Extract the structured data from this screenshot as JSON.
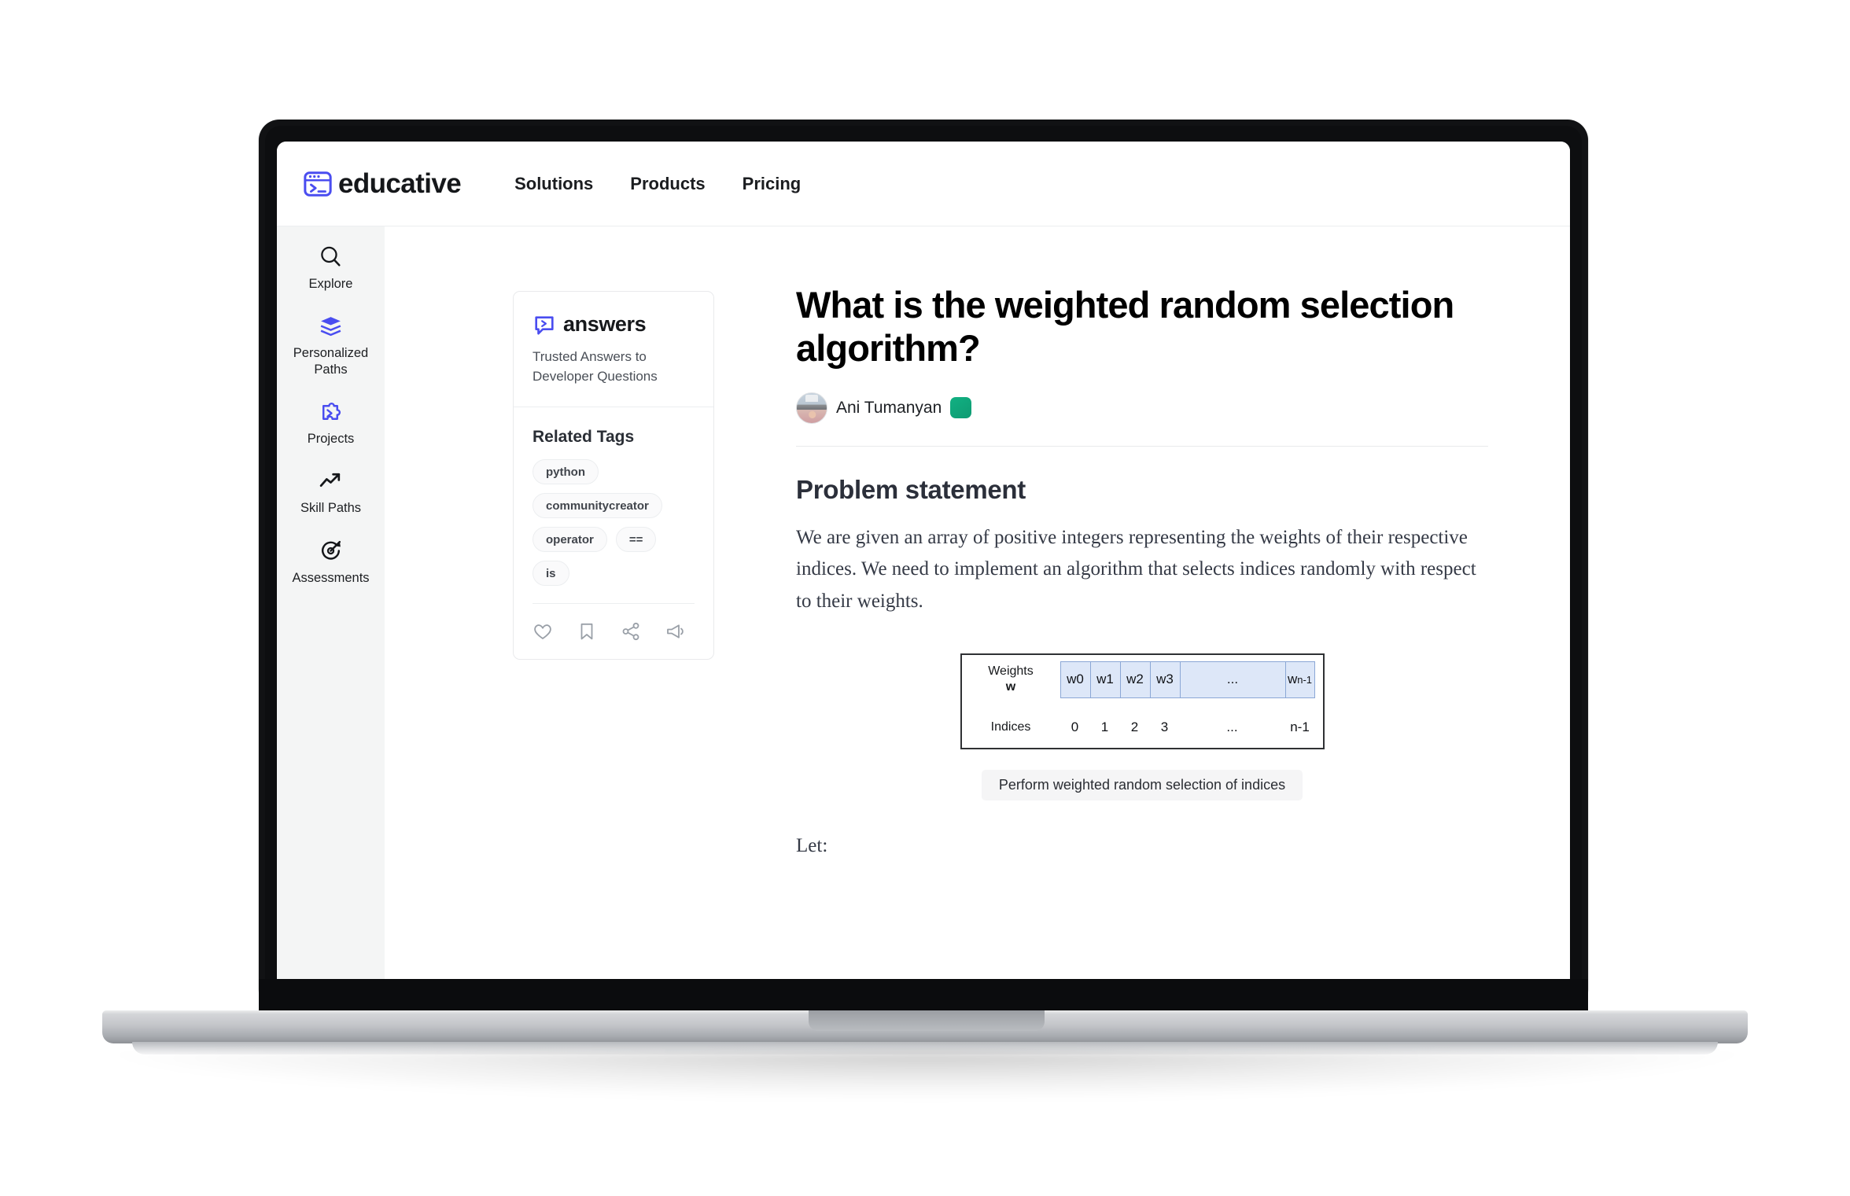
{
  "site": {
    "brand_name": "educative",
    "brand_icon": "terminal-window-icon",
    "nav": [
      {
        "label": "Solutions"
      },
      {
        "label": "Products"
      },
      {
        "label": "Pricing"
      }
    ]
  },
  "sidebar": {
    "items": [
      {
        "label": "Explore",
        "icon": "search-icon"
      },
      {
        "label": "Personalized Paths",
        "icon": "books-icon"
      },
      {
        "label": "Projects",
        "icon": "puzzle-code-icon"
      },
      {
        "label": "Skill Paths",
        "icon": "trending-up-icon"
      },
      {
        "label": "Assessments",
        "icon": "target-arrow-icon"
      }
    ]
  },
  "answers_card": {
    "logo_icon": "speech-bubble-code-icon",
    "logo_word": "answers",
    "tagline": "Trusted Answers to Developer Questions",
    "tags_title": "Related Tags",
    "tag_rows": [
      [
        "python"
      ],
      [
        "communitycreator"
      ],
      [
        "operator",
        "=="
      ],
      [
        "is"
      ]
    ],
    "actions": [
      {
        "icon": "heart-icon"
      },
      {
        "icon": "bookmark-icon"
      },
      {
        "icon": "share-icon"
      },
      {
        "icon": "megaphone-icon"
      }
    ]
  },
  "article": {
    "title": "What is the weighted random selection algorithm?",
    "author": "Ani Tumanyan",
    "author_badge_color": "#10a87a",
    "section_heading": "Problem statement",
    "paragraph": "We are given an array of positive integers representing the weights of their respective indices. We need to implement an algorithm that selects indices randomly with respect to their weights.",
    "figure": {
      "weights_label_line1": "Weights",
      "weights_label_line2": "w",
      "indices_label": "Indices",
      "weight_cells": [
        "w0",
        "w1",
        "w2",
        "w3",
        "...",
        "w"
      ],
      "last_cell_subscript": "n-1",
      "indices": [
        "0",
        "1",
        "2",
        "3",
        "...",
        "n-1"
      ],
      "caption": "Perform weighted random selection of indices",
      "cell_fill_color": "#dde7f8",
      "cell_border_color": "#8ba7d6"
    },
    "trailing_text": "Let:"
  }
}
